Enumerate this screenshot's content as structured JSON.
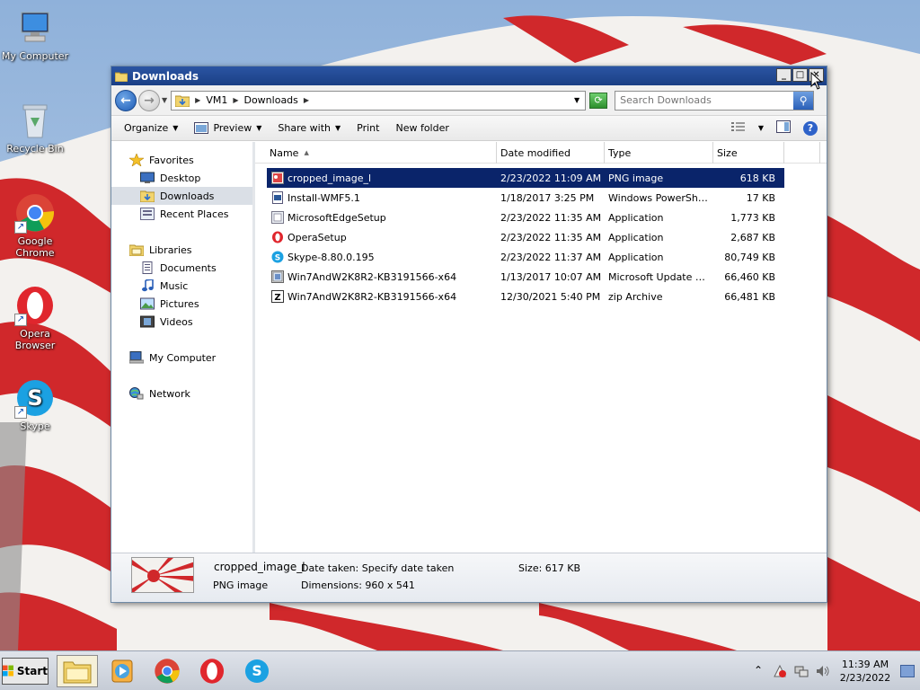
{
  "desktop": {
    "icons": [
      {
        "label": "My Computer"
      },
      {
        "label": "Recycle Bin"
      },
      {
        "label": "Google Chrome"
      },
      {
        "label": "Opera Browser"
      },
      {
        "label": "Skype"
      }
    ]
  },
  "window": {
    "title": "Downloads",
    "controls": {
      "minimize": "_",
      "maximize": "□",
      "close": "✕"
    }
  },
  "address": {
    "crumbs": [
      "VM1",
      "Downloads"
    ],
    "search_placeholder": "Search Downloads"
  },
  "toolbar": {
    "organize": "Organize",
    "preview": "Preview",
    "share_with": "Share with",
    "print": "Print",
    "new_folder": "New folder",
    "help": "?"
  },
  "navpane": {
    "favorites": "Favorites",
    "desktop": "Desktop",
    "downloads": "Downloads",
    "recent_places": "Recent Places",
    "libraries": "Libraries",
    "documents": "Documents",
    "music": "Music",
    "pictures": "Pictures",
    "videos": "Videos",
    "my_computer": "My Computer",
    "network": "Network"
  },
  "columns": {
    "name": "Name",
    "date_modified": "Date modified",
    "type": "Type",
    "size": "Size"
  },
  "files": [
    {
      "name": "cropped_image_l",
      "date": "2/23/2022 11:09 AM",
      "type": "PNG image",
      "size": "618 KB",
      "icon": "png-image-icon",
      "selected": true
    },
    {
      "name": "Install-WMF5.1",
      "date": "1/18/2017 3:25 PM",
      "type": "Windows PowerShel...",
      "size": "17 KB",
      "icon": "powershell-script-icon",
      "selected": false
    },
    {
      "name": "MicrosoftEdgeSetup",
      "date": "2/23/2022 11:35 AM",
      "type": "Application",
      "size": "1,773 KB",
      "icon": "edge-setup-icon",
      "selected": false
    },
    {
      "name": "OperaSetup",
      "date": "2/23/2022 11:35 AM",
      "type": "Application",
      "size": "2,687 KB",
      "icon": "opera-setup-icon",
      "selected": false
    },
    {
      "name": "Skype-8.80.0.195",
      "date": "2/23/2022 11:37 AM",
      "type": "Application",
      "size": "80,749 KB",
      "icon": "skype-setup-icon",
      "selected": false
    },
    {
      "name": "Win7AndW2K8R2-KB3191566-x64",
      "date": "1/13/2017 10:07 AM",
      "type": "Microsoft Update St...",
      "size": "66,460 KB",
      "icon": "update-package-icon",
      "selected": false
    },
    {
      "name": "Win7AndW2K8R2-KB3191566-x64",
      "date": "12/30/2021 5:40 PM",
      "type": "zip Archive",
      "size": "66,481 KB",
      "icon": "zip-archive-icon",
      "selected": false
    }
  ],
  "details": {
    "name": "cropped_image_l",
    "type": "PNG image",
    "date_taken": "Date taken: Specify date taken",
    "dimensions": "Dimensions: 960 x 541",
    "size": "Size: 617 KB"
  },
  "taskbar": {
    "start": "Start",
    "time": "11:39 AM",
    "date": "2/23/2022"
  }
}
